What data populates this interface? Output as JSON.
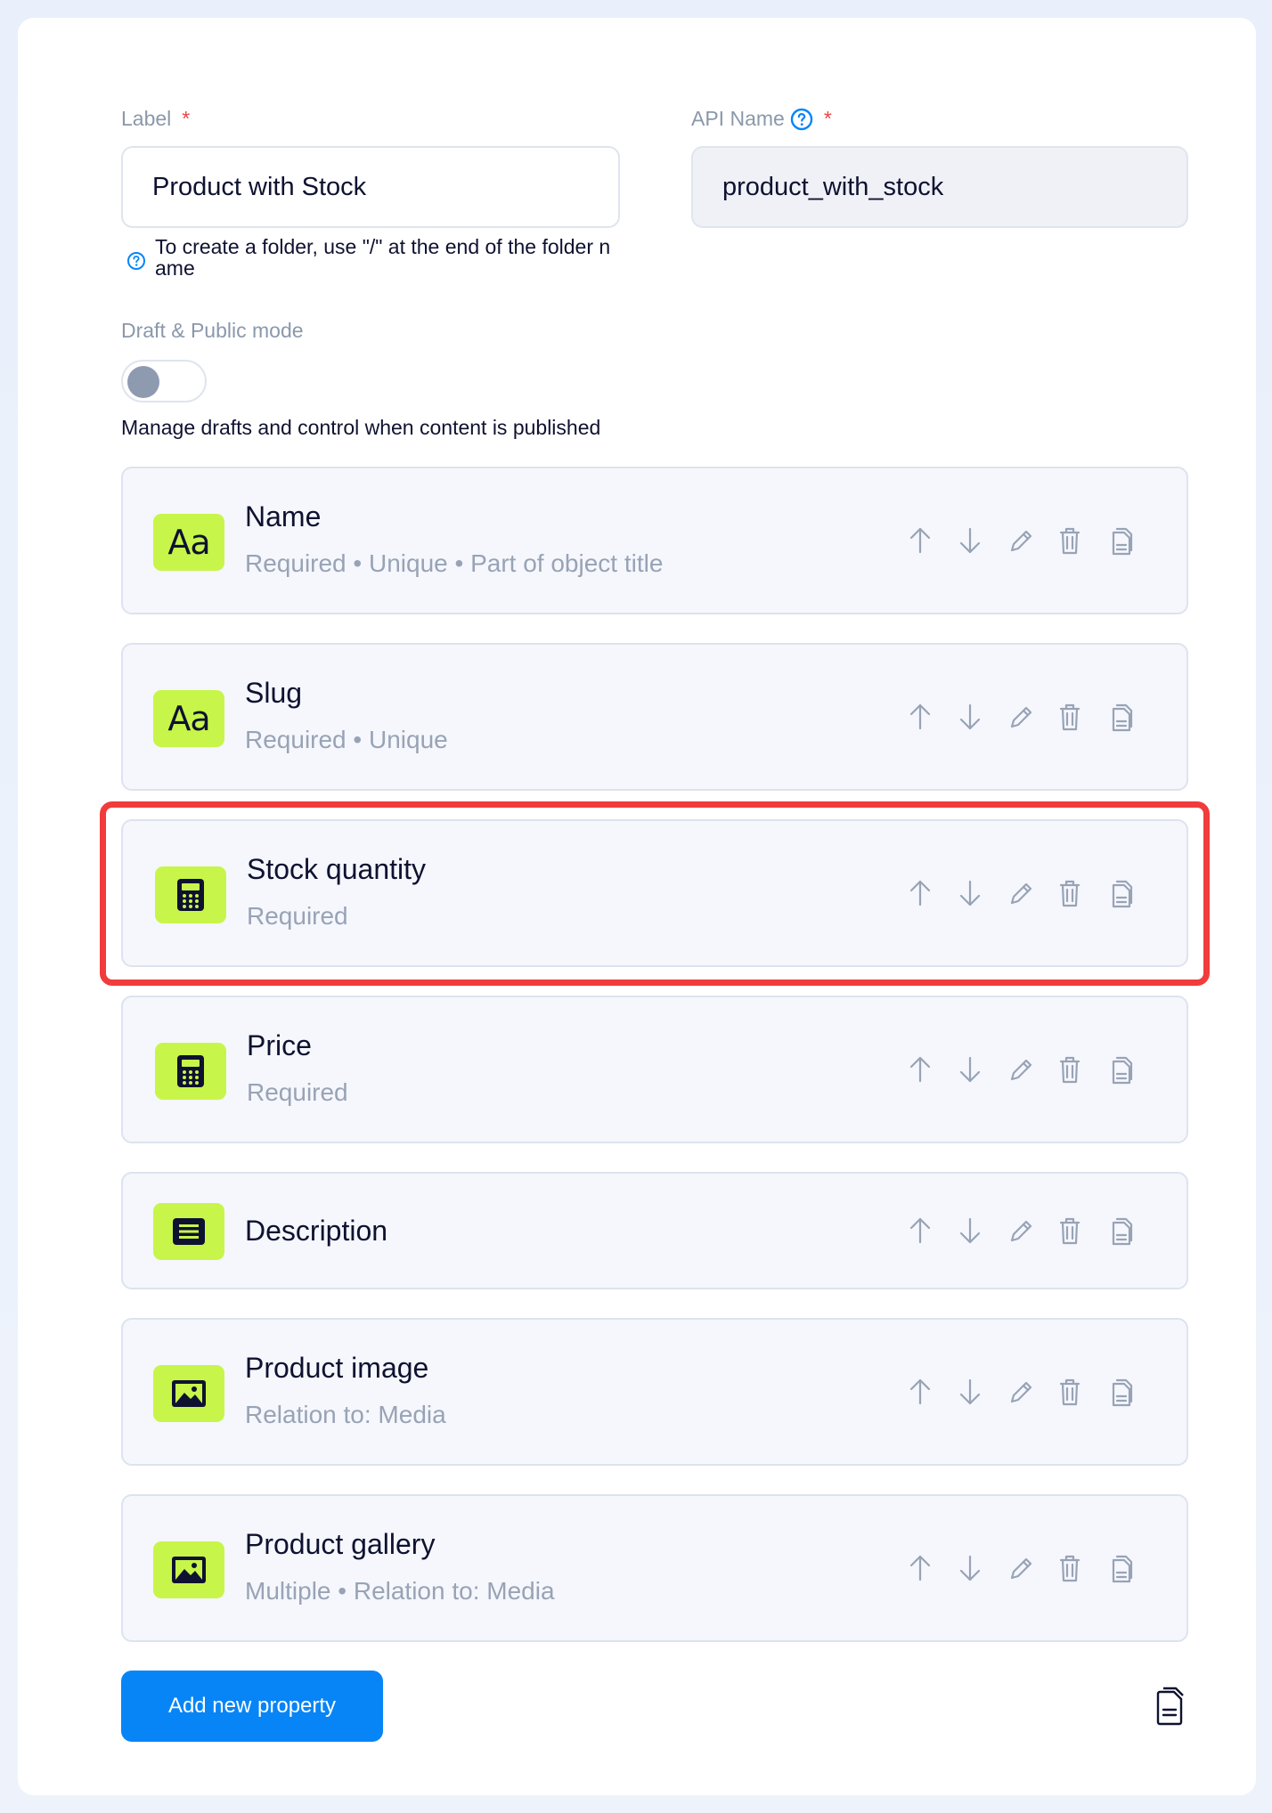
{
  "form": {
    "label_title": "Label",
    "label_required": "*",
    "label_value": "Product with Stock",
    "label_hint": "To create a folder, use \"/\" at the end of the folder name",
    "api_title": "API Name",
    "api_required": "*",
    "api_value": "product_with_stock",
    "draft_title": "Draft & Public mode",
    "draft_enabled": false,
    "draft_description": "Manage drafts and control when content is published"
  },
  "properties": [
    {
      "title": "Name",
      "meta": "Required • Unique • Part of object title",
      "icon": "text-icon"
    },
    {
      "title": "Slug",
      "meta": "Required • Unique",
      "icon": "text-icon"
    },
    {
      "title": "Stock quantity",
      "meta": "Required",
      "icon": "calculator-icon"
    },
    {
      "title": "Price",
      "meta": "Required",
      "icon": "calculator-icon"
    },
    {
      "title": "Description",
      "meta": "",
      "icon": "rich-text-icon"
    },
    {
      "title": "Product image",
      "meta": "Relation to: Media",
      "icon": "image-icon"
    },
    {
      "title": "Product gallery",
      "meta": "Multiple • Relation to: Media",
      "icon": "image-icon"
    }
  ],
  "icons": {
    "aa_glyph": "Aa"
  },
  "actions": {
    "add_property_label": "Add new property"
  },
  "colors": {
    "accent": "#0785f7",
    "icon_bg": "#c8f54a",
    "highlight": "#f23b3b"
  }
}
